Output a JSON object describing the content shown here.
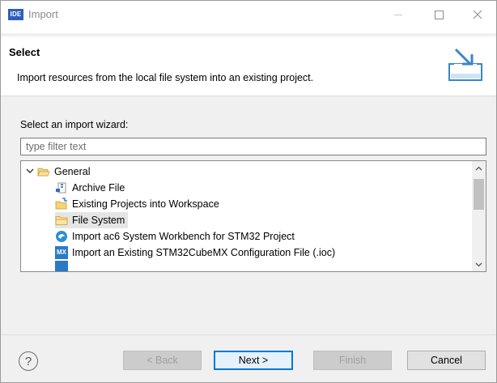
{
  "window": {
    "app_badge": "IDE",
    "title": "Import"
  },
  "banner": {
    "title": "Select",
    "description": "Import resources from the local file system into an existing project."
  },
  "wizard": {
    "label": "Select an import wizard:",
    "filter_placeholder": "type filter text",
    "filter_value": ""
  },
  "tree": {
    "group_label": "General",
    "items": [
      {
        "label": "Archive File",
        "icon": "archive-file-icon"
      },
      {
        "label": "Existing Projects into Workspace",
        "icon": "existing-projects-icon"
      },
      {
        "label": "File System",
        "icon": "folder-icon",
        "selected": true
      },
      {
        "label": "Import ac6 System Workbench for STM32 Project",
        "icon": "ac6-icon"
      },
      {
        "label": "Import an Existing STM32CubeMX Configuration File (.ioc)",
        "icon": "mx-icon",
        "badge": "MX"
      }
    ]
  },
  "buttons": {
    "help": "?",
    "back": "< Back",
    "next": "Next >",
    "finish": "Finish",
    "cancel": "Cancel"
  },
  "colors": {
    "accent": "#0078d7",
    "app_badge": "#2d5fb8",
    "selection": "#e5e5e5"
  }
}
